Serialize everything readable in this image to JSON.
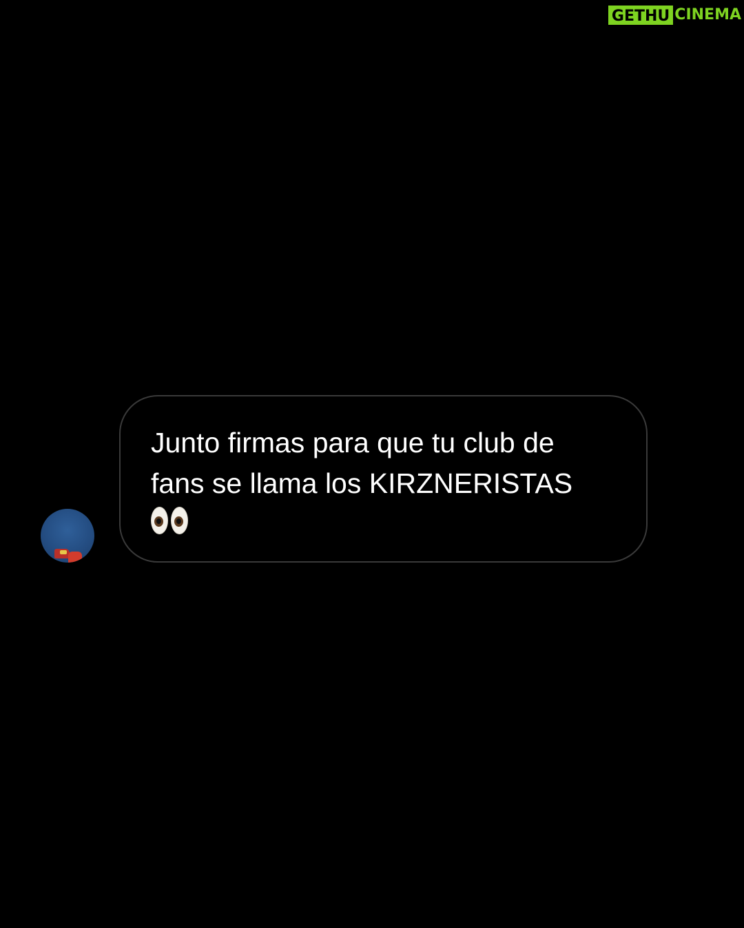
{
  "watermark": {
    "part1": "GETHU",
    "part2": "CINEMA",
    "color": "#7ed321"
  },
  "message": {
    "text": "Junto firmas para que tu club de\nfans se llama los KIRZNERISTAS",
    "emoji": "eyes-emoji",
    "bubble_border_color": "#3a3a3a",
    "text_color": "#ffffff"
  },
  "avatar": {
    "icon": "profile-photo"
  },
  "background_color": "#000000"
}
